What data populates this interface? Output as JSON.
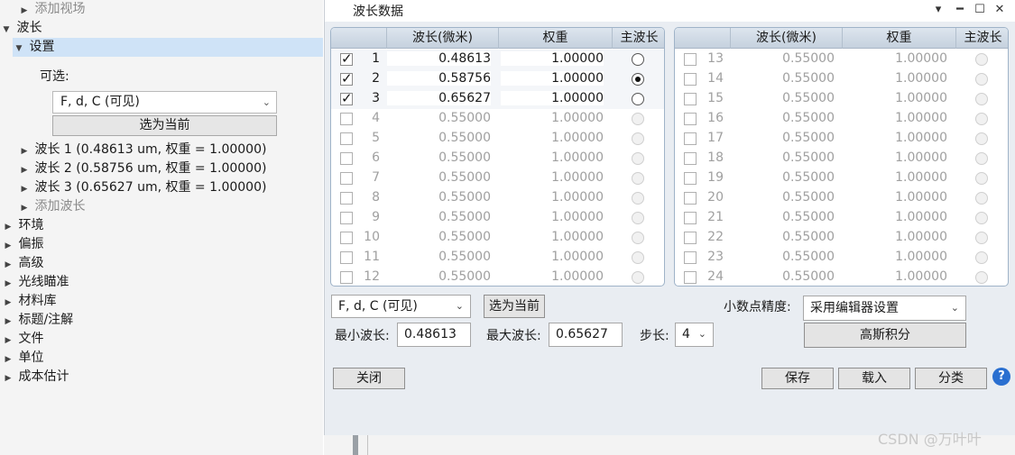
{
  "tree": {
    "items": [
      {
        "label": "添加视场",
        "expanded": false,
        "dim": true
      },
      {
        "label": "波长",
        "expanded": true
      },
      {
        "label": "设置",
        "expanded": true,
        "selected": true
      },
      {
        "label": "波长 1 (0.48613 um, 权重 = 1.00000)"
      },
      {
        "label": "波长 2 (0.58756 um, 权重 = 1.00000)"
      },
      {
        "label": "波长 3 (0.65627 um, 权重 = 1.00000)"
      },
      {
        "label": "添加波长",
        "dim": true
      },
      {
        "label": "环境"
      },
      {
        "label": "偏振"
      },
      {
        "label": "高级"
      },
      {
        "label": "光线瞄准"
      },
      {
        "label": "材料库"
      },
      {
        "label": "标题/注解"
      },
      {
        "label": "文件"
      },
      {
        "label": "单位"
      },
      {
        "label": "成本估计"
      }
    ],
    "optional_label": "可选:",
    "preset_value": "F, d, C (可见)",
    "apply_label": "选为当前"
  },
  "dialog": {
    "title": "波长数据",
    "columns": [
      "波长(微米)",
      "权重",
      "主波长"
    ],
    "rows_left": [
      {
        "n": "1",
        "wavelength": "0.48613",
        "weight": "1.00000",
        "checked": true,
        "primary": false,
        "active": true
      },
      {
        "n": "2",
        "wavelength": "0.58756",
        "weight": "1.00000",
        "checked": true,
        "primary": true,
        "active": true
      },
      {
        "n": "3",
        "wavelength": "0.65627",
        "weight": "1.00000",
        "checked": true,
        "primary": false,
        "active": true
      },
      {
        "n": "4",
        "wavelength": "0.55000",
        "weight": "1.00000",
        "checked": false
      },
      {
        "n": "5",
        "wavelength": "0.55000",
        "weight": "1.00000",
        "checked": false
      },
      {
        "n": "6",
        "wavelength": "0.55000",
        "weight": "1.00000",
        "checked": false
      },
      {
        "n": "7",
        "wavelength": "0.55000",
        "weight": "1.00000",
        "checked": false
      },
      {
        "n": "8",
        "wavelength": "0.55000",
        "weight": "1.00000",
        "checked": false
      },
      {
        "n": "9",
        "wavelength": "0.55000",
        "weight": "1.00000",
        "checked": false
      },
      {
        "n": "10",
        "wavelength": "0.55000",
        "weight": "1.00000",
        "checked": false
      },
      {
        "n": "11",
        "wavelength": "0.55000",
        "weight": "1.00000",
        "checked": false
      },
      {
        "n": "12",
        "wavelength": "0.55000",
        "weight": "1.00000",
        "checked": false
      }
    ],
    "rows_right": [
      {
        "n": "13",
        "wavelength": "0.55000",
        "weight": "1.00000",
        "checked": false
      },
      {
        "n": "14",
        "wavelength": "0.55000",
        "weight": "1.00000",
        "checked": false
      },
      {
        "n": "15",
        "wavelength": "0.55000",
        "weight": "1.00000",
        "checked": false
      },
      {
        "n": "16",
        "wavelength": "0.55000",
        "weight": "1.00000",
        "checked": false
      },
      {
        "n": "17",
        "wavelength": "0.55000",
        "weight": "1.00000",
        "checked": false
      },
      {
        "n": "18",
        "wavelength": "0.55000",
        "weight": "1.00000",
        "checked": false
      },
      {
        "n": "19",
        "wavelength": "0.55000",
        "weight": "1.00000",
        "checked": false
      },
      {
        "n": "20",
        "wavelength": "0.55000",
        "weight": "1.00000",
        "checked": false
      },
      {
        "n": "21",
        "wavelength": "0.55000",
        "weight": "1.00000",
        "checked": false
      },
      {
        "n": "22",
        "wavelength": "0.55000",
        "weight": "1.00000",
        "checked": false
      },
      {
        "n": "23",
        "wavelength": "0.55000",
        "weight": "1.00000",
        "checked": false
      },
      {
        "n": "24",
        "wavelength": "0.55000",
        "weight": "1.00000",
        "checked": false
      }
    ],
    "preset_value": "F, d, C (可见)",
    "apply_label": "选为当前",
    "precision_label": "小数点精度:",
    "precision_value": "采用编辑器设置",
    "gauss_label": "高斯积分",
    "min_label": "最小波长:",
    "min_value": "0.48613",
    "max_label": "最大波长:",
    "max_value": "0.65627",
    "step_label": "步长:",
    "step_value": "4",
    "close_label": "关闭",
    "save_label": "保存",
    "load_label": "载入",
    "sort_label": "分类",
    "help_glyph": "?"
  },
  "watermark": "CSDN @万叶叶"
}
